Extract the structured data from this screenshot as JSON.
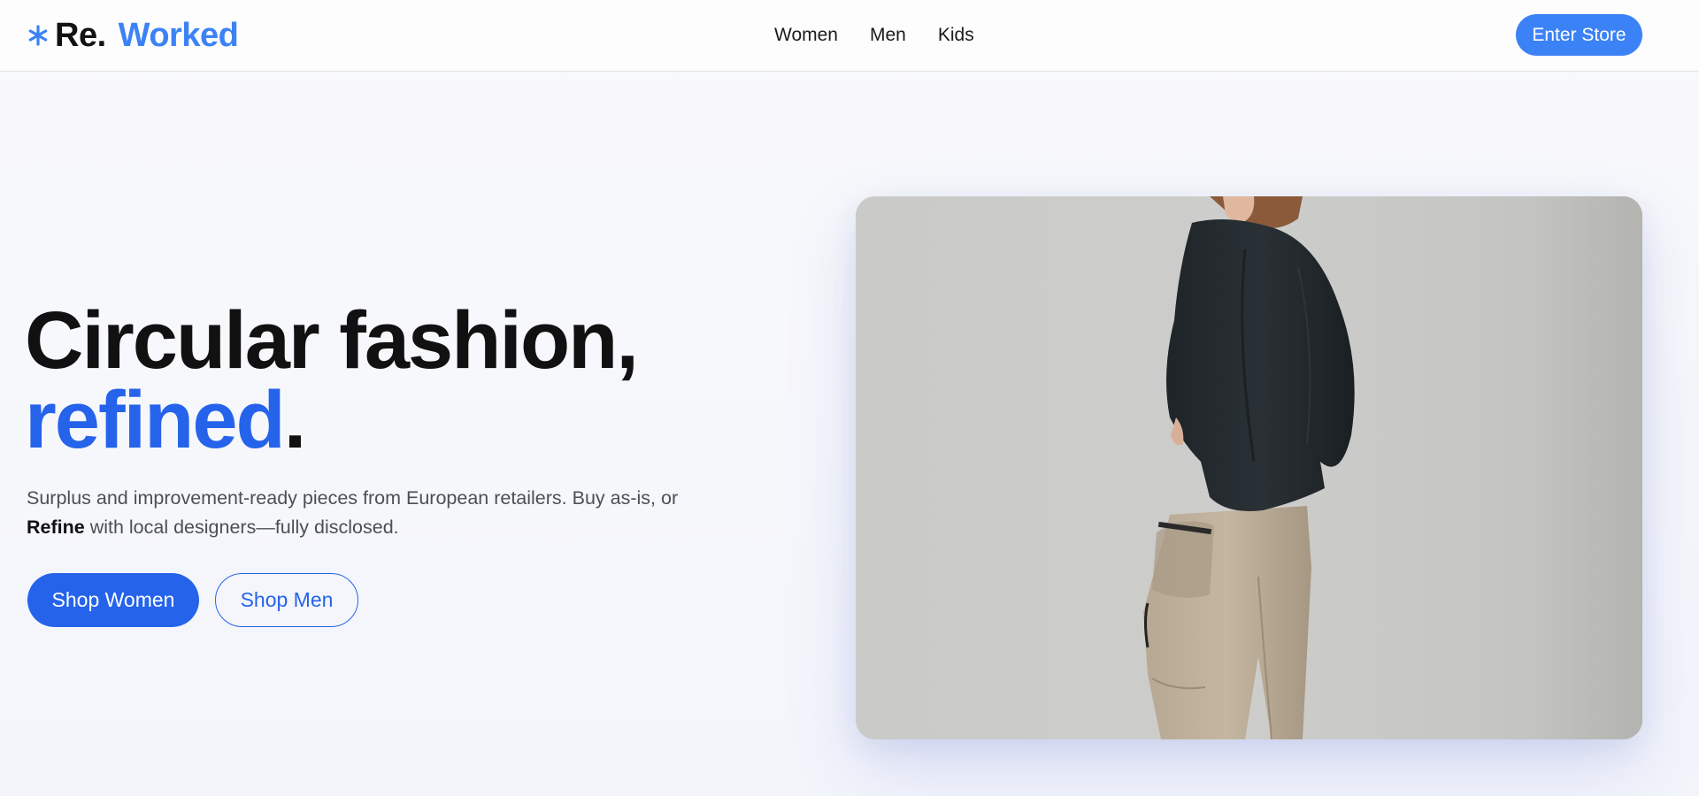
{
  "header": {
    "logo": {
      "icon": "star-icon",
      "part1": "Re.",
      "part2": "Worked"
    },
    "nav": [
      {
        "label": "Women"
      },
      {
        "label": "Men"
      },
      {
        "label": "Kids"
      }
    ],
    "cta_label": "Enter Store"
  },
  "hero": {
    "title_line1": "Circular fashion,",
    "title_accent": "refined",
    "title_end": ".",
    "subtitle_part1": "Surplus and improvement-ready pieces from European retailers. Buy as-is, or ",
    "subtitle_bold": "Refine",
    "subtitle_part2": " with local designers—fully disclosed.",
    "primary_button": "Shop Women",
    "secondary_button": "Shop Men"
  },
  "colors": {
    "accent": "#3b82f6",
    "primary": "#2563eb",
    "text": "#111111",
    "background": "#f7f8fb"
  }
}
